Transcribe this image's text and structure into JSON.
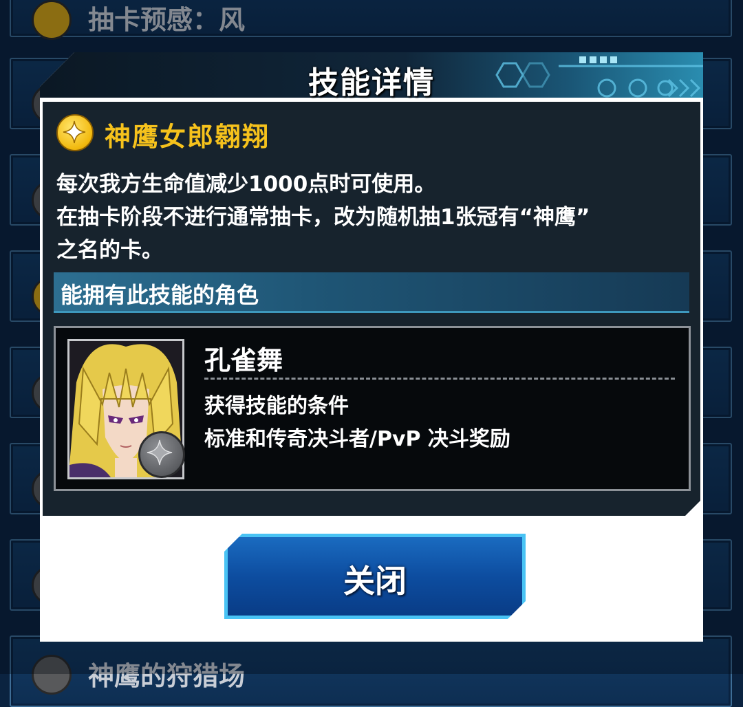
{
  "background": {
    "top_item_text": "抽卡预感：风",
    "bottom_item_text": "神鹰的狩猎场"
  },
  "modal": {
    "title": "技能详情",
    "skill": {
      "icon": "star-icon",
      "name": "神鹰女郎翱翔",
      "description_lines": [
        "每次我方生命值减少1000点时可使用。",
        "在抽卡阶段不进行通常抽卡，改为随机抽1张冠有“神鹰”",
        "之名的卡。"
      ]
    },
    "section_title": "能拥有此技能的角色",
    "character": {
      "name": "孔雀舞",
      "condition_label": "获得技能的条件",
      "condition_value": "标准和传奇决斗者/PvP 决斗奖励",
      "badge_icon": "star-icon"
    },
    "close_label": "关闭"
  },
  "colors": {
    "accent_gold": "#f6c21c",
    "panel_bg": "#17232d",
    "button_border": "#49c3f4",
    "button_fill": "#0d4da0"
  }
}
